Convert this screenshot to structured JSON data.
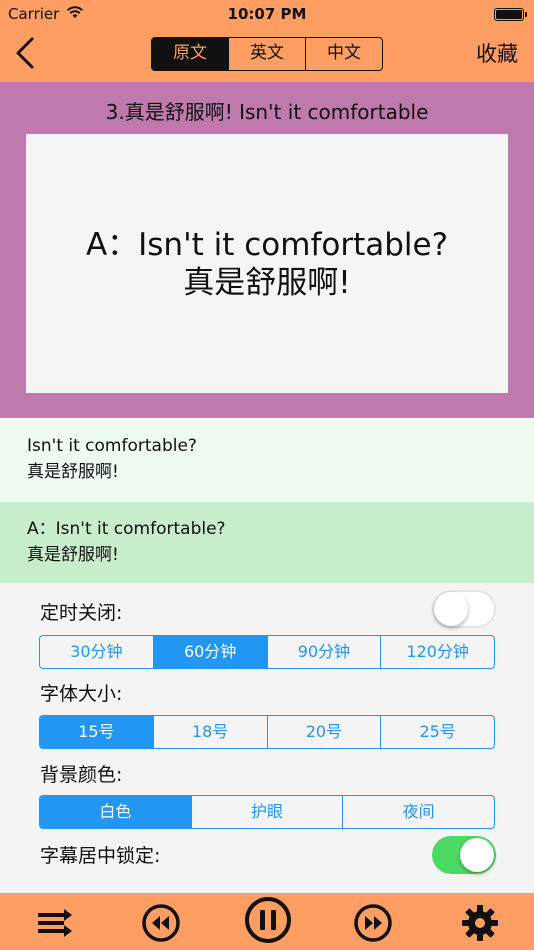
{
  "status_bar": {
    "carrier": "Carrier",
    "time": "10:07 PM"
  },
  "header": {
    "tabs": [
      {
        "label": "原文",
        "active": true
      },
      {
        "label": "英文",
        "active": false
      },
      {
        "label": "中文",
        "active": false
      }
    ],
    "favorite_label": "收藏"
  },
  "lesson": {
    "title": "3.真是舒服啊!  Isn't it comfortable",
    "card_line_en": "A：Isn't it comfortable?",
    "card_line_zh": "真是舒服啊!"
  },
  "sentences": [
    {
      "en": "Isn't it comfortable?",
      "zh": "真是舒服啊!"
    },
    {
      "en": "A：Isn't it comfortable?",
      "zh": "真是舒服啊!"
    }
  ],
  "settings": {
    "timer": {
      "label": "定时关闭:",
      "enabled": false,
      "options": [
        "30分钟",
        "60分钟",
        "90分钟",
        "120分钟"
      ],
      "selected": "60分钟"
    },
    "font_size": {
      "label": "字体大小:",
      "options": [
        "15号",
        "18号",
        "20号",
        "25号"
      ],
      "selected": "15号"
    },
    "background": {
      "label": "背景颜色:",
      "options": [
        "白色",
        "护眼",
        "夜间"
      ],
      "selected": "白色"
    },
    "subtitle_lock": {
      "label": "字幕居中锁定:",
      "enabled": true
    }
  },
  "toolbar": {
    "icons": [
      "playlist-icon",
      "rewind-icon",
      "pause-icon",
      "fast-forward-icon",
      "gear-icon"
    ]
  },
  "colors": {
    "header_bg": "#ff9e63",
    "lesson_bg": "#bf7aad",
    "accent_blue": "#2196f3",
    "toggle_on": "#4cd964",
    "row_highlight": "#c8edcd"
  }
}
